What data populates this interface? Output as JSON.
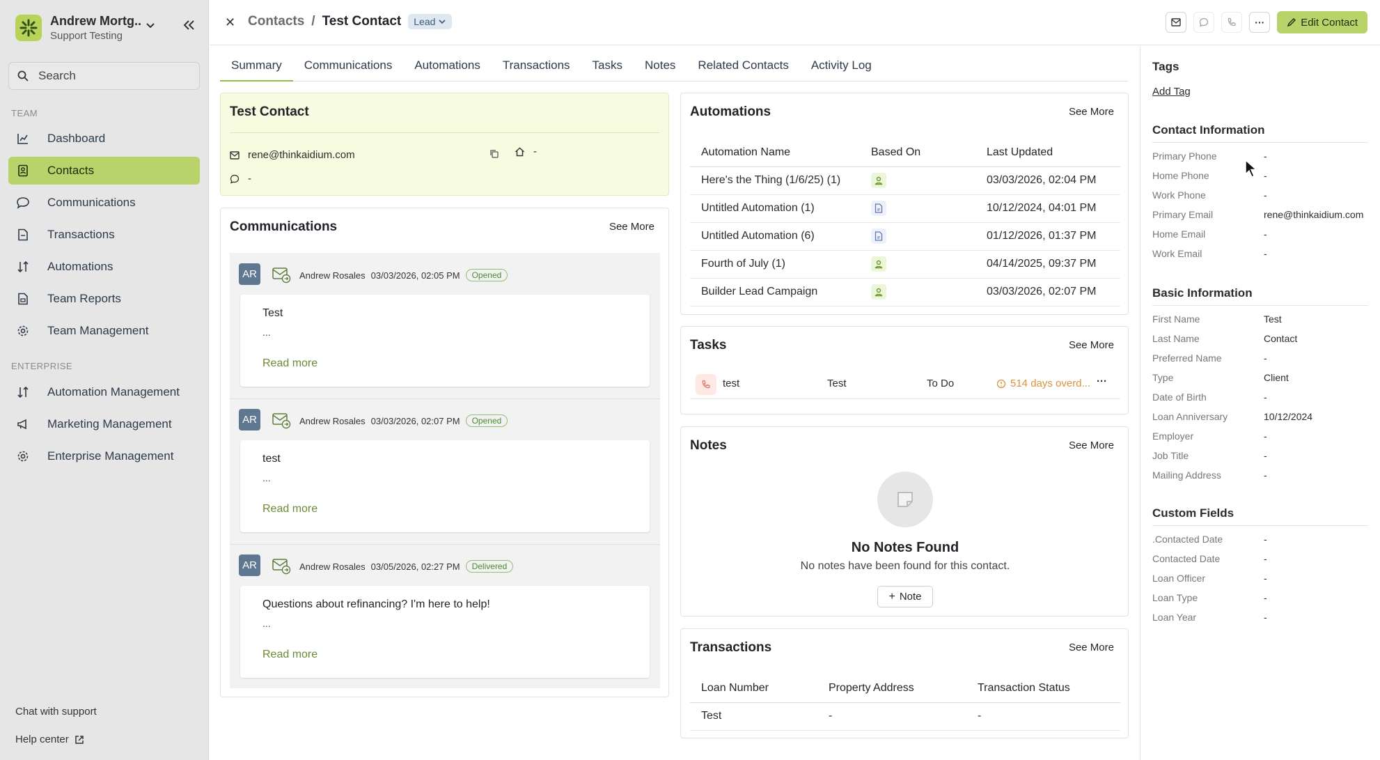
{
  "sidebar": {
    "org_name": "Andrew Mortg...",
    "org_sub": "Support Testing",
    "search_placeholder": "Search",
    "section_team": "TEAM",
    "section_enterprise": "ENTERPRISE",
    "team_items": [
      {
        "label": "Dashboard",
        "icon": "chart-line-icon"
      },
      {
        "label": "Contacts",
        "icon": "contact-book-icon",
        "active": true
      },
      {
        "label": "Communications",
        "icon": "chat-bubble-icon"
      },
      {
        "label": "Transactions",
        "icon": "document-icon"
      },
      {
        "label": "Automations",
        "icon": "sort-arrows-icon"
      },
      {
        "label": "Team Reports",
        "icon": "report-icon"
      },
      {
        "label": "Team Management",
        "icon": "gear-icon"
      }
    ],
    "enterprise_items": [
      {
        "label": "Automation Management",
        "icon": "sort-arrows-icon"
      },
      {
        "label": "Marketing Management",
        "icon": "megaphone-icon"
      },
      {
        "label": "Enterprise Management",
        "icon": "gear-icon"
      }
    ],
    "chat_support": "Chat with support",
    "help_center": "Help center"
  },
  "header": {
    "breadcrumb_parent": "Contacts",
    "breadcrumb_sep": "/",
    "breadcrumb_current": "Test Contact",
    "badge": "Lead",
    "edit_label": "Edit Contact"
  },
  "tabs": [
    "Summary",
    "Communications",
    "Automations",
    "Transactions",
    "Tasks",
    "Notes",
    "Related Contacts",
    "Activity Log"
  ],
  "contact": {
    "name": "Test Contact",
    "email": "rene@thinkaidium.com",
    "home_value": "-",
    "chat_value": "-"
  },
  "communications": {
    "title": "Communications",
    "see_more": "See More",
    "items": [
      {
        "initials": "AR",
        "author": "Andrew Rosales",
        "date": "03/03/2026, 02:05 PM",
        "status": "Opened",
        "subject": "Test",
        "preview": "...",
        "read_more": "Read more"
      },
      {
        "initials": "AR",
        "author": "Andrew Rosales",
        "date": "03/03/2026, 02:07 PM",
        "status": "Opened",
        "subject": "test",
        "preview": "...",
        "read_more": "Read more"
      },
      {
        "initials": "AR",
        "author": "Andrew Rosales",
        "date": "03/05/2026, 02:27 PM",
        "status": "Delivered",
        "subject": "Questions about refinancing? I'm here to help!",
        "preview": "...",
        "read_more": "Read more"
      }
    ]
  },
  "automations": {
    "title": "Automations",
    "see_more": "See More",
    "columns": [
      "Automation Name",
      "Based On",
      "Last Updated"
    ],
    "rows": [
      {
        "name": "Here's the Thing (1/6/25) (1)",
        "based": "person-icon",
        "updated": "03/03/2026, 02:04 PM"
      },
      {
        "name": "Untitled Automation (1)",
        "based": "document-icon",
        "updated": "10/12/2024, 04:01 PM"
      },
      {
        "name": "Untitled Automation (6)",
        "based": "document-icon",
        "updated": "01/12/2026, 01:37 PM"
      },
      {
        "name": "Fourth of July (1)",
        "based": "person-icon",
        "updated": "04/14/2025, 09:37 PM"
      },
      {
        "name": "Builder Lead Campaign",
        "based": "person-icon",
        "updated": "03/03/2026, 02:07 PM"
      }
    ]
  },
  "tasks": {
    "title": "Tasks",
    "see_more": "See More",
    "rows": [
      {
        "name": "test",
        "contact": "Test",
        "status": "To Do",
        "due": "514 days overd..."
      }
    ]
  },
  "notes": {
    "title": "Notes",
    "see_more": "See More",
    "empty_title": "No Notes Found",
    "empty_sub": "No notes have been found for this contact.",
    "add_label": "Note"
  },
  "transactions": {
    "title": "Transactions",
    "see_more": "See More",
    "columns": [
      "Loan Number",
      "Property Address",
      "Transaction Status"
    ],
    "rows": [
      {
        "loan": "Test",
        "address": "-",
        "status": "-"
      }
    ]
  },
  "right_panel": {
    "tags_title": "Tags",
    "add_tag": "Add Tag",
    "contact_info_title": "Contact Information",
    "contact_info": [
      {
        "label": "Primary Phone",
        "value": "-"
      },
      {
        "label": "Home Phone",
        "value": "-"
      },
      {
        "label": "Work Phone",
        "value": "-"
      },
      {
        "label": "Primary Email",
        "value": "rene@thinkaidium.com"
      },
      {
        "label": "Home Email",
        "value": "-"
      },
      {
        "label": "Work Email",
        "value": "-"
      }
    ],
    "basic_info_title": "Basic Information",
    "basic_info": [
      {
        "label": "First Name",
        "value": "Test"
      },
      {
        "label": "Last Name",
        "value": "Contact"
      },
      {
        "label": "Preferred Name",
        "value": "-"
      },
      {
        "label": "Type",
        "value": "Client"
      },
      {
        "label": "Date of Birth",
        "value": "-"
      },
      {
        "label": "Loan Anniversary",
        "value": "10/12/2024"
      },
      {
        "label": "Employer",
        "value": "-"
      },
      {
        "label": "Job Title",
        "value": "-"
      },
      {
        "label": "Mailing Address",
        "value": "-"
      }
    ],
    "custom_fields_title": "Custom Fields",
    "custom_fields": [
      {
        "label": ".Contacted Date",
        "value": "-"
      },
      {
        "label": "Contacted Date",
        "value": "-"
      },
      {
        "label": "Loan Officer",
        "value": "-"
      },
      {
        "label": "Loan Type",
        "value": "-"
      },
      {
        "label": "Loan Year",
        "value": "-"
      }
    ]
  },
  "colors": {
    "accent": "#b7d36a",
    "link_green": "#6c8a36",
    "overdue": "#d9923b"
  }
}
